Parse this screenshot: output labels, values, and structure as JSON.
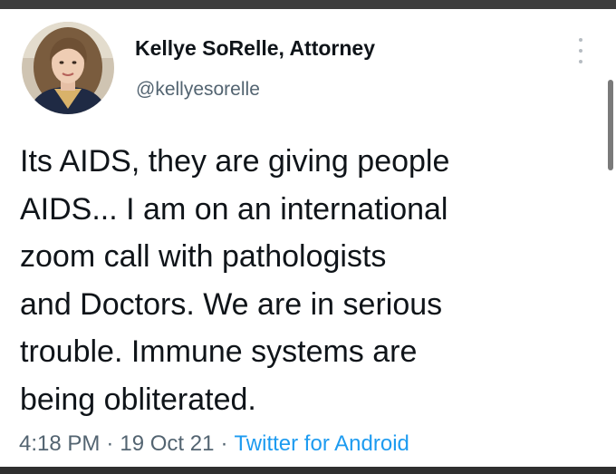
{
  "user": {
    "name": "Kellye SoRelle, Attorney",
    "handle": "@kellyesorelle",
    "avatar_icon": "profile-photo"
  },
  "menu": {
    "icon": "more-options-icon"
  },
  "tweet": {
    "lines": [
      "Its AIDS, they are giving people",
      "AIDS... I am on an international",
      "zoom call with pathologists",
      "and Doctors. We are in serious",
      "trouble. Immune systems are",
      "being obliterated."
    ]
  },
  "meta": {
    "time": "4:18 PM",
    "separator": "·",
    "date": "19 Oct 21",
    "source": "Twitter for Android"
  },
  "colors": {
    "text": "#0f1419",
    "secondary": "#536471",
    "link": "#1d9bf0"
  }
}
